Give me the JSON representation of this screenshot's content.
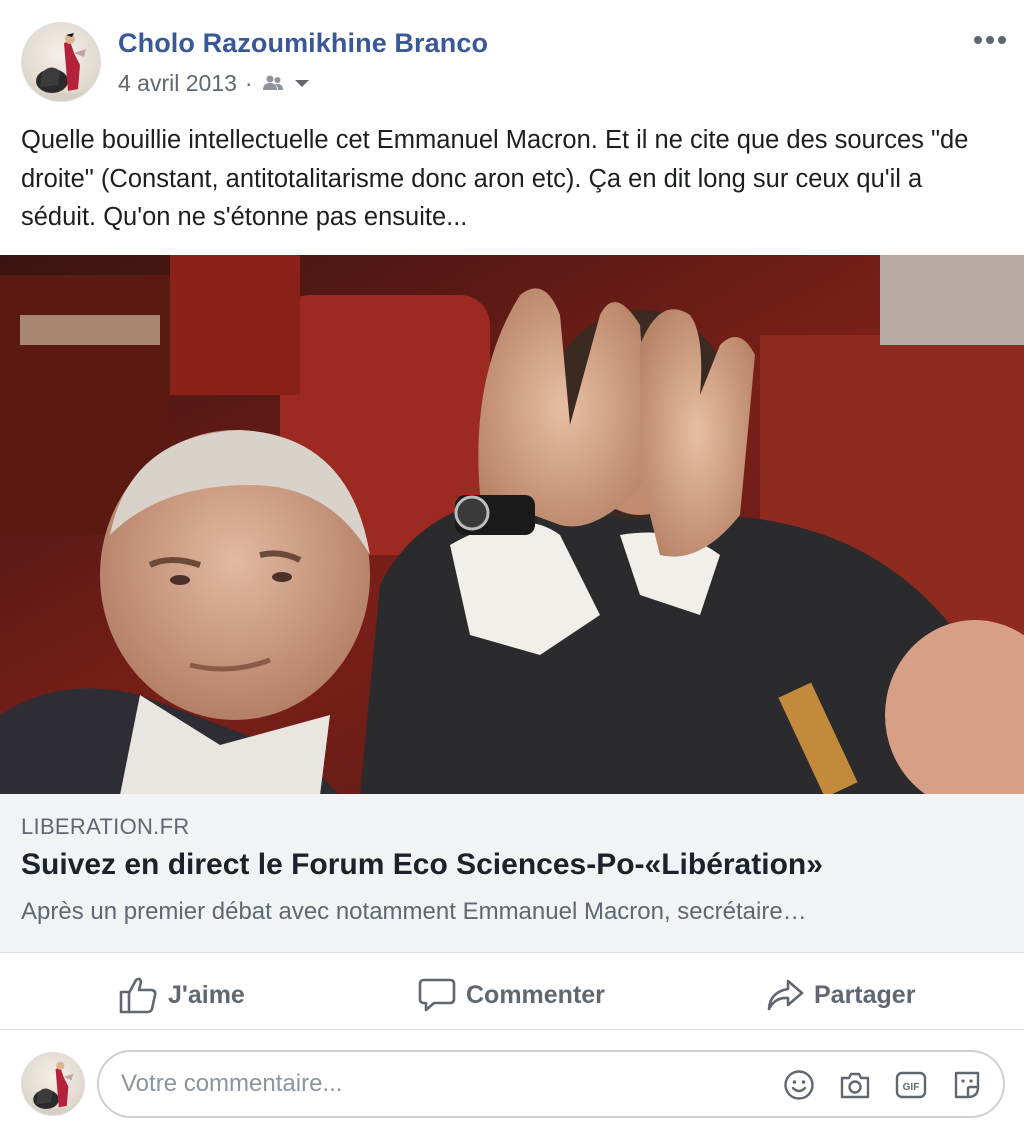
{
  "post": {
    "author": "Cholo Razoumikhine Branco",
    "date": "4 avril 2013",
    "separator": "·",
    "audience_icon": "friends-icon",
    "text": "Quelle bouillie intellectuelle cet Emmanuel Macron. Et il ne cite que des sources \"de droite\" (Constant, antitotalitarisme donc aron etc). Ça en dit long sur ceux qu'il a séduit. Qu'on ne s'étonne pas ensuite..."
  },
  "link": {
    "domain": "LIBERATION.FR",
    "title": "Suivez en direct le Forum Eco Sciences-Po-«Libération»",
    "description": "Après un premier débat avec notamment Emmanuel Macron, secrétaire…"
  },
  "actions": {
    "like": "J'aime",
    "comment": "Commenter",
    "share": "Partager"
  },
  "composer": {
    "placeholder": "Votre commentaire..."
  },
  "colors": {
    "author": "#385898",
    "secondary": "#606770",
    "caption_bg": "#f2f3f5"
  }
}
